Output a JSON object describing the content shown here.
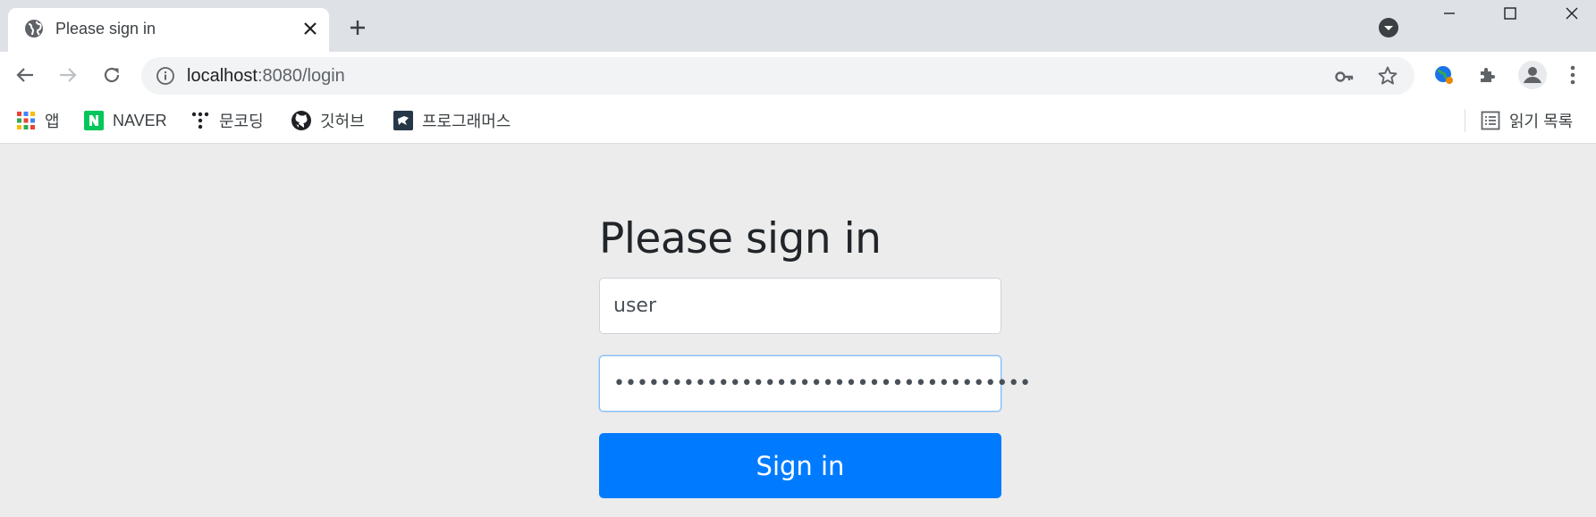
{
  "browser": {
    "tab": {
      "title": "Please sign in"
    },
    "address_bar": {
      "host": "localhost",
      "rest": ":8080/login"
    },
    "bookmarks": [
      {
        "label": "앱",
        "icon": "apps-grid-icon"
      },
      {
        "label": "NAVER",
        "icon": "naver-icon"
      },
      {
        "label": "문코딩",
        "icon": "moon-coding-icon"
      },
      {
        "label": "깃허브",
        "icon": "github-icon"
      },
      {
        "label": "프로그래머스",
        "icon": "programmers-icon"
      }
    ],
    "reading_list_label": "읽기 목록"
  },
  "page": {
    "heading": "Please sign in",
    "username_value": "user",
    "password_value": "••••••••••••••••••••••••••••••••••••",
    "submit_label": "Sign in"
  },
  "colors": {
    "primary_button": "#007bff",
    "page_background": "#ececec",
    "tabstrip_background": "#dee1e6"
  }
}
